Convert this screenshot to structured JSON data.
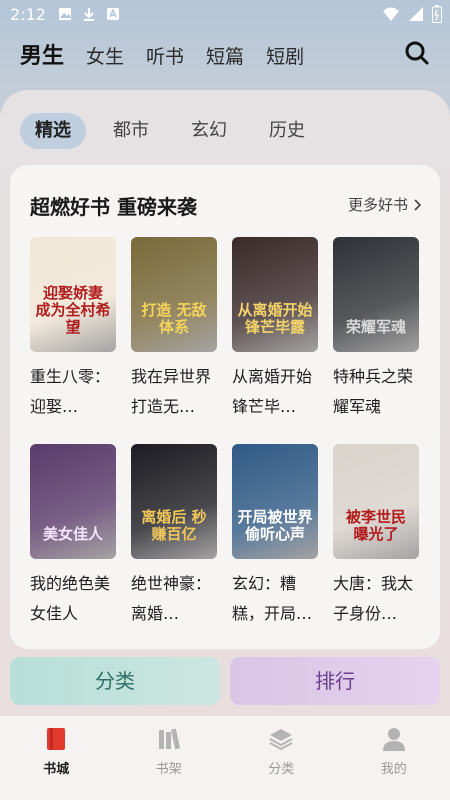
{
  "status_bar": {
    "time": "2:12"
  },
  "channels": [
    {
      "label": "男生",
      "active": true
    },
    {
      "label": "女生",
      "active": false
    },
    {
      "label": "听书",
      "active": false
    },
    {
      "label": "短篇",
      "active": false
    },
    {
      "label": "短剧",
      "active": false
    }
  ],
  "subtabs": [
    {
      "label": "精选",
      "active": true
    },
    {
      "label": "都市",
      "active": false
    },
    {
      "label": "玄幻",
      "active": false
    },
    {
      "label": "历史",
      "active": false
    }
  ],
  "card": {
    "title": "超燃好书 重磅来袭",
    "more_label": "更多好书",
    "books": [
      {
        "title": "重生八零：迎娶…",
        "cover_text": "迎娶娇妻 成为全村希望",
        "cover_bg": "#f1e7d6",
        "cover_fg": "#b11d1d"
      },
      {
        "title": "我在异世界打造无…",
        "cover_text": "打造 无敌体系",
        "cover_bg": "#7a6a3a",
        "cover_fg": "#f6d35a"
      },
      {
        "title": "从离婚开始锋芒毕…",
        "cover_text": "从离婚开始 锋芒毕露",
        "cover_bg": "#3a2a2a",
        "cover_fg": "#f3d36a"
      },
      {
        "title": "特种兵之荣耀军魂",
        "cover_text": "荣耀军魂",
        "cover_bg": "#2e3236",
        "cover_fg": "#d9d9d9"
      },
      {
        "title": "我的绝色美女佳人",
        "cover_text": "美女佳人",
        "cover_bg": "#5a3a6a",
        "cover_fg": "#f4e6ff"
      },
      {
        "title": "绝世神豪：离婚…",
        "cover_text": "离婚后 秒赚百亿",
        "cover_bg": "#1c1c22",
        "cover_fg": "#f1c75a"
      },
      {
        "title": "玄幻：糟糕，开局…",
        "cover_text": "开局被世界 偷听心声",
        "cover_bg": "#2f5a86",
        "cover_fg": "#ffffff"
      },
      {
        "title": "大唐：我太子身份…",
        "cover_text": "被李世民 曝光了",
        "cover_bg": "#d9d3cc",
        "cover_fg": "#b31b1b"
      }
    ]
  },
  "quick": {
    "classify": "分类",
    "rank": "排行"
  },
  "bottom_nav": [
    {
      "label": "书城",
      "icon": "book-icon",
      "active": true
    },
    {
      "label": "书架",
      "icon": "bookshelf-icon",
      "active": false
    },
    {
      "label": "分类",
      "icon": "layers-icon",
      "active": false
    },
    {
      "label": "我的",
      "icon": "user-icon",
      "active": false
    }
  ]
}
